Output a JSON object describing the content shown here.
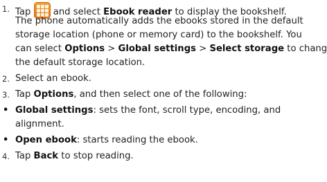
{
  "steps": {
    "s1": {
      "num": "1.",
      "pre_icon": "Tap",
      "icon": "app-drawer-icon",
      "after_icon": "and select",
      "app_name": "Ebook reader",
      "after_app": "to display the bookshelf.",
      "line2": "The phone automatically adds the ebooks stored in the default",
      "line3": "storage location (phone or memory card) to the bookshelf. You",
      "line4_pre": "can select",
      "opt": "Options",
      "sep1": ">",
      "global": "Global settings",
      "sep2": ">",
      "select_storage": "Select storage",
      "line4_post": "to change",
      "line5": "the default storage location."
    },
    "s2": {
      "num": "2.",
      "text": "Select an ebook."
    },
    "s3": {
      "num": "3.",
      "pre": "Tap",
      "options": "Options",
      "post": ", and then select one of the following:"
    },
    "bullets": [
      {
        "term": "Global settings",
        "text": ": sets the font, scroll type, encoding, and",
        "text2": "alignment."
      },
      {
        "term": "Open ebook",
        "text": ": starts reading the ebook."
      }
    ],
    "s4": {
      "num": "4.",
      "pre": "Tap",
      "back": "Back",
      "post": "to stop reading."
    }
  }
}
